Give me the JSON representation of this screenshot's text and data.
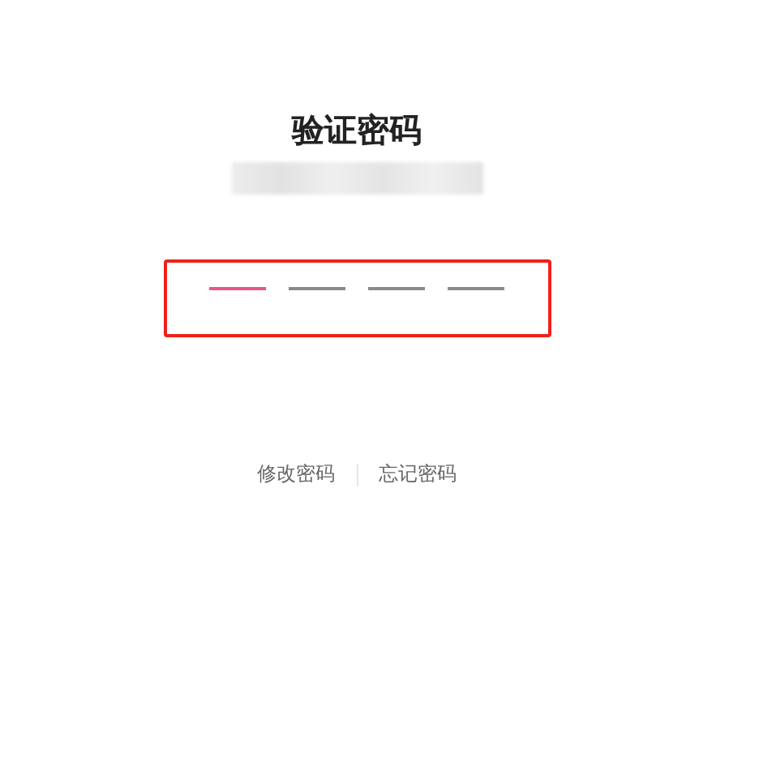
{
  "title": "验证密码",
  "code_slots": [
    {
      "selected": true
    },
    {
      "selected": false
    },
    {
      "selected": false
    },
    {
      "selected": false
    }
  ],
  "links": [
    "修改密码",
    "忘记密码"
  ]
}
